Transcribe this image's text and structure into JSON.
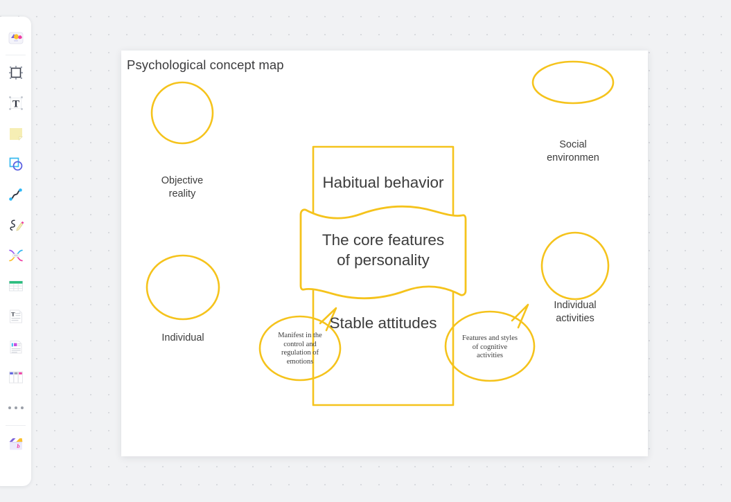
{
  "app": {
    "canvas_background": "#f1f2f4",
    "page_background": "#ffffff"
  },
  "toolbar": {
    "name": "left-tool-rail",
    "items": [
      {
        "icon": "shapes-library-icon",
        "label": "Shapes library"
      },
      {
        "icon": "frame-icon",
        "label": "Frame"
      },
      {
        "icon": "text-icon",
        "label": "Text"
      },
      {
        "icon": "sticky-note-icon",
        "label": "Sticky note"
      },
      {
        "icon": "shape-icon",
        "label": "Shape"
      },
      {
        "icon": "curve-connector-icon",
        "label": "Connector"
      },
      {
        "icon": "pen-icon",
        "label": "Pen"
      },
      {
        "icon": "mind-map-icon",
        "label": "Mind map"
      },
      {
        "icon": "table-icon",
        "label": "Table"
      },
      {
        "icon": "document-icon",
        "label": "Document"
      },
      {
        "icon": "note-card-icon",
        "label": "Note card"
      },
      {
        "icon": "kanban-icon",
        "label": "Kanban board"
      },
      {
        "icon": "more-icon",
        "label": "More"
      },
      {
        "icon": "toolbox-icon",
        "label": "Toolbox"
      }
    ]
  },
  "page": {
    "title": "Psychological concept map"
  },
  "diagram": {
    "stroke_color": "#f5c31c",
    "text_color": "#3c3c3c",
    "center": {
      "rectangle": {
        "lines": [
          {
            "name": "habitual-behavior",
            "text": "Habitual behavior"
          },
          {
            "name": "stable-attitudes",
            "text": "Stable attitudes"
          }
        ]
      },
      "banner": {
        "name": "core-features-banner",
        "text": "The core features\nof personality"
      }
    },
    "ellipses": [
      {
        "name": "objective-reality",
        "text": "Objective\nreality"
      },
      {
        "name": "social-environment",
        "text": "Social\nenvironmen"
      },
      {
        "name": "individual",
        "text": "Individual"
      },
      {
        "name": "individual-activities",
        "text": "Individual\nactivities"
      }
    ],
    "callouts": [
      {
        "name": "emotion-regulation-callout",
        "text": "Manifest in the\ncontrol and\nregulation of\nemotions"
      },
      {
        "name": "cognitive-styles-callout",
        "text": "Features and styles\nof cognitive\nactivities"
      }
    ]
  }
}
